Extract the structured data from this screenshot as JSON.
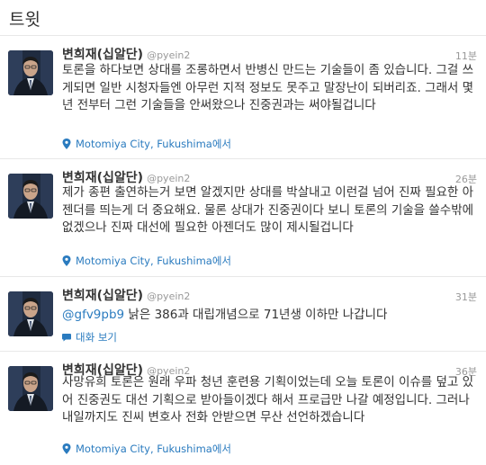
{
  "header": {
    "title": "트윗"
  },
  "tweets": [
    {
      "name": "변희재(십알단)",
      "handle": "@pyein2",
      "time": "11분",
      "text": "토론을 하다보면 상대를 조롱하면서 반병신 만드는 기술들이 좀 있습니다. 그걸 쓰게되면 일반 시청자들엔 아무런 지적 정보도 못주고 말장난이 되버리죠. 그래서 몇년 전부터 그런 기술들을 안써왔으나 진중권과는 써야될겁니다",
      "location": "Motomiya City, Fukushima에서",
      "location_icon": "location-pin-icon"
    },
    {
      "name": "변희재(십알단)",
      "handle": "@pyein2",
      "time": "26분",
      "text": "제가 종편 출연하는거 보면 알겠지만 상대를 박살내고 이런걸 넘어 진짜 필요한 아젠더를 띄는게 더 중요해요. 물론 상대가 진중권이다 보니 토론의 기술을 쓸수밖에 없겠으나 진짜 대선에 필요한 아젠더도 많이 제시될겁니다",
      "location": "Motomiya City, Fukushima에서",
      "location_icon": "location-pin-icon"
    },
    {
      "name": "변희재(십알단)",
      "handle": "@pyein2",
      "time": "31분",
      "mention": "@gfv9pb9",
      "text": " 낡은 386과 대립개념으로 71년생 이하만 나갑니다",
      "conversation": "대화 보기",
      "conversation_icon": "conversation-bubble-icon"
    },
    {
      "name": "변희재(십알단)",
      "handle": "@pyein2",
      "time": "36분",
      "text": "사망유희 토론은 원래 우파 청년 훈련용 기획이었는데 오늘 토론이 이슈를 덮고 있어 진중권도 대선 기획으로 받아들이겠다 해서 프로급만 나갈 예정입니다. 그러나 내일까지도 진씨 변호사 전화 안받으면 무산 선언하겠습니다",
      "location": "Motomiya City, Fukushima에서",
      "location_icon": "location-pin-icon"
    }
  ],
  "colors": {
    "link": "#2a7bbf",
    "meta_text": "#999999",
    "body_text": "#333333",
    "divider": "#e8e8e8"
  }
}
